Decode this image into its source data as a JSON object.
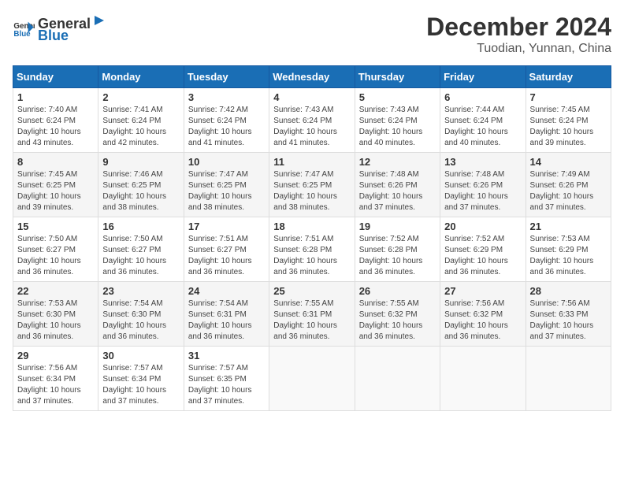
{
  "logo": {
    "text_general": "General",
    "text_blue": "Blue"
  },
  "title": "December 2024",
  "subtitle": "Tuodian, Yunnan, China",
  "days_of_week": [
    "Sunday",
    "Monday",
    "Tuesday",
    "Wednesday",
    "Thursday",
    "Friday",
    "Saturday"
  ],
  "weeks": [
    [
      {
        "day": "1",
        "sunrise": "7:40 AM",
        "sunset": "6:24 PM",
        "daylight": "10 hours and 43 minutes."
      },
      {
        "day": "2",
        "sunrise": "7:41 AM",
        "sunset": "6:24 PM",
        "daylight": "10 hours and 42 minutes."
      },
      {
        "day": "3",
        "sunrise": "7:42 AM",
        "sunset": "6:24 PM",
        "daylight": "10 hours and 41 minutes."
      },
      {
        "day": "4",
        "sunrise": "7:43 AM",
        "sunset": "6:24 PM",
        "daylight": "10 hours and 41 minutes."
      },
      {
        "day": "5",
        "sunrise": "7:43 AM",
        "sunset": "6:24 PM",
        "daylight": "10 hours and 40 minutes."
      },
      {
        "day": "6",
        "sunrise": "7:44 AM",
        "sunset": "6:24 PM",
        "daylight": "10 hours and 40 minutes."
      },
      {
        "day": "7",
        "sunrise": "7:45 AM",
        "sunset": "6:24 PM",
        "daylight": "10 hours and 39 minutes."
      }
    ],
    [
      {
        "day": "8",
        "sunrise": "7:45 AM",
        "sunset": "6:25 PM",
        "daylight": "10 hours and 39 minutes."
      },
      {
        "day": "9",
        "sunrise": "7:46 AM",
        "sunset": "6:25 PM",
        "daylight": "10 hours and 38 minutes."
      },
      {
        "day": "10",
        "sunrise": "7:47 AM",
        "sunset": "6:25 PM",
        "daylight": "10 hours and 38 minutes."
      },
      {
        "day": "11",
        "sunrise": "7:47 AM",
        "sunset": "6:25 PM",
        "daylight": "10 hours and 38 minutes."
      },
      {
        "day": "12",
        "sunrise": "7:48 AM",
        "sunset": "6:26 PM",
        "daylight": "10 hours and 37 minutes."
      },
      {
        "day": "13",
        "sunrise": "7:48 AM",
        "sunset": "6:26 PM",
        "daylight": "10 hours and 37 minutes."
      },
      {
        "day": "14",
        "sunrise": "7:49 AM",
        "sunset": "6:26 PM",
        "daylight": "10 hours and 37 minutes."
      }
    ],
    [
      {
        "day": "15",
        "sunrise": "7:50 AM",
        "sunset": "6:27 PM",
        "daylight": "10 hours and 36 minutes."
      },
      {
        "day": "16",
        "sunrise": "7:50 AM",
        "sunset": "6:27 PM",
        "daylight": "10 hours and 36 minutes."
      },
      {
        "day": "17",
        "sunrise": "7:51 AM",
        "sunset": "6:27 PM",
        "daylight": "10 hours and 36 minutes."
      },
      {
        "day": "18",
        "sunrise": "7:51 AM",
        "sunset": "6:28 PM",
        "daylight": "10 hours and 36 minutes."
      },
      {
        "day": "19",
        "sunrise": "7:52 AM",
        "sunset": "6:28 PM",
        "daylight": "10 hours and 36 minutes."
      },
      {
        "day": "20",
        "sunrise": "7:52 AM",
        "sunset": "6:29 PM",
        "daylight": "10 hours and 36 minutes."
      },
      {
        "day": "21",
        "sunrise": "7:53 AM",
        "sunset": "6:29 PM",
        "daylight": "10 hours and 36 minutes."
      }
    ],
    [
      {
        "day": "22",
        "sunrise": "7:53 AM",
        "sunset": "6:30 PM",
        "daylight": "10 hours and 36 minutes."
      },
      {
        "day": "23",
        "sunrise": "7:54 AM",
        "sunset": "6:30 PM",
        "daylight": "10 hours and 36 minutes."
      },
      {
        "day": "24",
        "sunrise": "7:54 AM",
        "sunset": "6:31 PM",
        "daylight": "10 hours and 36 minutes."
      },
      {
        "day": "25",
        "sunrise": "7:55 AM",
        "sunset": "6:31 PM",
        "daylight": "10 hours and 36 minutes."
      },
      {
        "day": "26",
        "sunrise": "7:55 AM",
        "sunset": "6:32 PM",
        "daylight": "10 hours and 36 minutes."
      },
      {
        "day": "27",
        "sunrise": "7:56 AM",
        "sunset": "6:32 PM",
        "daylight": "10 hours and 36 minutes."
      },
      {
        "day": "28",
        "sunrise": "7:56 AM",
        "sunset": "6:33 PM",
        "daylight": "10 hours and 37 minutes."
      }
    ],
    [
      {
        "day": "29",
        "sunrise": "7:56 AM",
        "sunset": "6:34 PM",
        "daylight": "10 hours and 37 minutes."
      },
      {
        "day": "30",
        "sunrise": "7:57 AM",
        "sunset": "6:34 PM",
        "daylight": "10 hours and 37 minutes."
      },
      {
        "day": "31",
        "sunrise": "7:57 AM",
        "sunset": "6:35 PM",
        "daylight": "10 hours and 37 minutes."
      },
      null,
      null,
      null,
      null
    ]
  ]
}
